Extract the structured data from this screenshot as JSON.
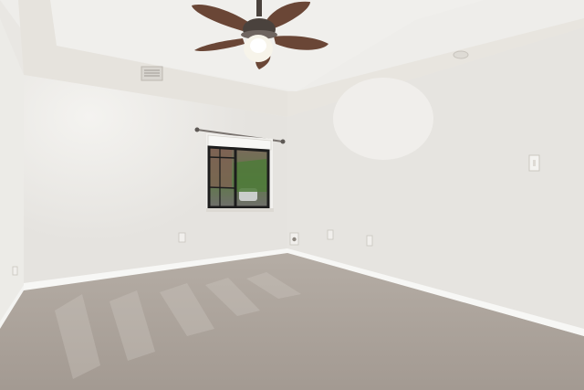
{
  "scene": {
    "elements": [
      "tray-ceiling",
      "ceiling-fan",
      "fan-light",
      "air-vent",
      "recessed-light",
      "window",
      "curtain-rod",
      "window-shade",
      "light-switch",
      "wall-outlet",
      "baseboard",
      "carpet-floor"
    ]
  },
  "colors": {
    "ceiling": "#eeedea",
    "tray_soffit": "#e6e3dd",
    "left_wall": "#ecebe7",
    "back_wall": "#e9e7e3",
    "right_wall": "#e6e4e0",
    "baseboard": "#f7f7f5",
    "carpet": "#a79e96",
    "carpet_highlight": "#c0b9b1",
    "window_frame": "#1d1d1d",
    "fan_blade": "#6a4636",
    "fan_housing": "#4a423d",
    "fan_light_glass": "#f7f4ea"
  }
}
